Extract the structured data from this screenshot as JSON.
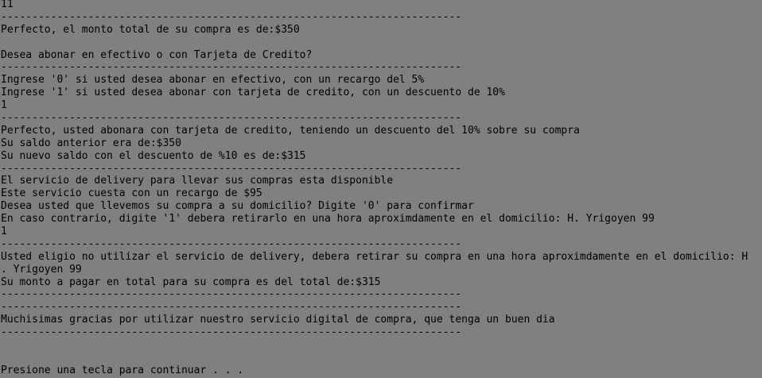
{
  "window": {
    "background": "#808080",
    "text_color": "#000000"
  },
  "console": {
    "lines": [
      "11",
      "--------------------------------------------------------------------------",
      "Perfecto, el monto total de su compra es de:$350",
      "",
      "Desea abonar en efectivo o con Tarjeta de Credito?",
      "--------------------------------------------------------------------------",
      "Ingrese '0' si usted desea abonar en efectivo, con un recargo del 5%",
      "Ingrese '1' si usted desea abonar con tarjeta de credito, con un descuento de 10%",
      "1",
      "--------------------------------------------------------------------------",
      "Perfecto, usted abonara con tarjeta de credito, teniendo un descuento del 10% sobre su compra",
      "Su saldo anterior era de:$350",
      "Su nuevo saldo con el descuento de %10 es de:$315",
      "--------------------------------------------------------------------------",
      "El servicio de delivery para llevar sus compras esta disponible",
      "Este servicio cuesta con un recargo de $95",
      "Desea usted que llevemos su compra a su domicilio? Digite '0' para confirmar",
      "En caso contrario, digite '1' debera retirarlo en una hora aproximdamente en el domicilio: H. Yrigoyen 99",
      "1",
      "--------------------------------------------------------------------------",
      "Usted eligio no utilizar el servicio de delivery, debera retirar su compra en una hora aproximdamente en el domicilio: H",
      ". Yrigoyen 99",
      "Su monto a pagar en total para su compra es del total de:$315",
      "--------------------------------------------------------------------------",
      "--------------------------------------------------------------------------",
      "Muchisimas gracias por utilizar nuestro servicio digital de compra, que tenga un buen dia",
      "--------------------------------------------------------------------------",
      "",
      "",
      "Presione una tecla para continuar . . ."
    ]
  }
}
